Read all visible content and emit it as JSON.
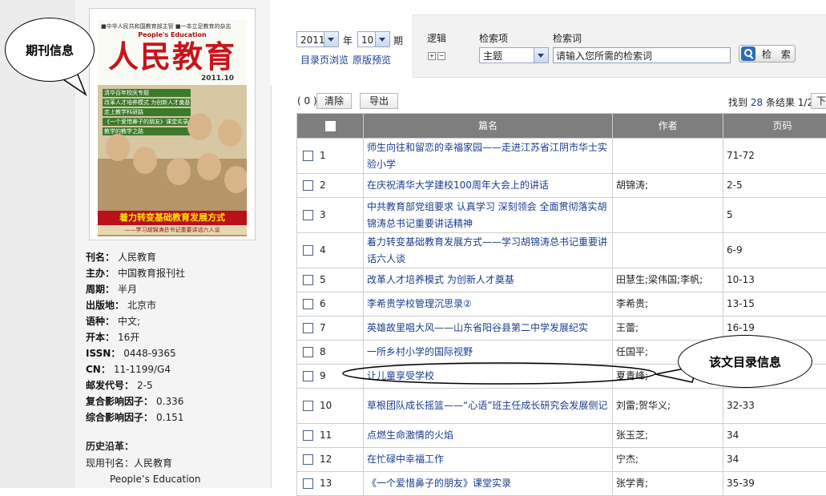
{
  "journal": {
    "cover_header": "■中华人民共和国教育部主管 ■一本立足教育的杂志",
    "cover_english": "People's Education",
    "cover_title": "人民教育",
    "cover_issue": "2011.10",
    "cover_lines": [
      "清华百年校庆专题",
      "改革人才培养模式 为创新人才奠基",
      "走上教学科研路",
      "《一个爱惜鼻子的朋友》课堂实录",
      "教学的教学之路"
    ],
    "cover_headline": "着力转变基础教育发展方式",
    "cover_subline": "——学习胡锦涛总书记重要讲话六人谈",
    "info": [
      {
        "key": "刊名：",
        "value": "人民教育"
      },
      {
        "key": "主办：",
        "value": "中国教育报刊社"
      },
      {
        "key": "周期：",
        "value": "半月"
      },
      {
        "key": "出版地：",
        "value": "北京市"
      },
      {
        "key": "语种：",
        "value": "中文;"
      },
      {
        "key": "开本：",
        "value": "16开"
      },
      {
        "key": "ISSN：",
        "value": "0448-9365"
      },
      {
        "key": "CN：",
        "value": "11-1199/G4"
      },
      {
        "key": "邮发代号：",
        "value": "2-5"
      },
      {
        "key": "复合影响因子：",
        "value": "0.336"
      },
      {
        "key": "综合影响因子：",
        "value": "0.151"
      }
    ],
    "history_label": "历史沿革：",
    "current_name": "现用刊名：人民教育",
    "english_name": "People’s Education"
  },
  "toolbar": {
    "year": "2011",
    "year_unit": "年",
    "issue": "10",
    "issue_unit": "期",
    "toc_link": "目录页浏览",
    "original_link": "原版预览",
    "logic_label": "逻辑",
    "field_label": "检索项",
    "keyword_label": "检索词",
    "field_value": "主题",
    "search_placeholder": "请输入您所需的检索词",
    "search_button": "检 索"
  },
  "results_bar": {
    "selected_count": "( 0 )",
    "clear_label": "清除",
    "export_label": "导出",
    "found_prefix": "找到",
    "found_count": "28",
    "found_suffix": "条结果",
    "page_info": "1/2",
    "next_label": "下"
  },
  "table": {
    "headers": {
      "title": "篇名",
      "author": "作者",
      "pages": "页码"
    },
    "rows": [
      {
        "num": "1",
        "title": "师生向往和留恋的幸福家园——走进江苏省江阴市华士实验小学",
        "author": "",
        "pages": "71-72",
        "tall": true
      },
      {
        "num": "2",
        "title": "在庆祝清华大学建校100周年大会上的讲话",
        "author": "胡锦涛;",
        "pages": "2-5",
        "tall": false
      },
      {
        "num": "3",
        "title": "中共教育部党组要求 认真学习 深刻领会 全面贯彻落实胡锦涛总书记重要讲话精神",
        "author": "",
        "pages": "5",
        "tall": true
      },
      {
        "num": "4",
        "title": "着力转变基础教育发展方式——学习胡锦涛总书记重要讲话六人谈",
        "author": "",
        "pages": "6-9",
        "tall": true
      },
      {
        "num": "5",
        "title": "改革人才培养模式 为创新人才奠基",
        "author": "田慧生;梁伟国;李帆;",
        "pages": "10-13",
        "tall": false
      },
      {
        "num": "6",
        "title": "李希贵学校管理沉思录②",
        "author": "李希贵;",
        "pages": "13-15",
        "tall": false
      },
      {
        "num": "7",
        "title": "英雄故里唱大风——山东省阳谷县第二中学发展纪实",
        "author": "王蕾;",
        "pages": "16-19",
        "tall": false
      },
      {
        "num": "8",
        "title": "一所乡村小学的国际视野",
        "author": "任国平;",
        "pages": "",
        "tall": false
      },
      {
        "num": "9",
        "title": "让儿童享受学校",
        "author": "夏青峰;",
        "pages": "",
        "tall": false
      },
      {
        "num": "10",
        "title": "草根团队成长摇篮——“心语”班主任成长研究会发展侧记",
        "author": "刘雷;贺华义;",
        "pages": "32-33",
        "tall": true
      },
      {
        "num": "11",
        "title": "点燃生命激情的火焰",
        "author": "张玉芝;",
        "pages": "34",
        "tall": false
      },
      {
        "num": "12",
        "title": "在忙碌中幸福工作",
        "author": "宁杰;",
        "pages": "34",
        "tall": false
      },
      {
        "num": "13",
        "title": "《一个爱惜鼻子的朋友》课堂实录",
        "author": "张学青;",
        "pages": "35-39",
        "tall": false
      }
    ]
  },
  "callouts": {
    "journal_info": "期刊信息",
    "article_info": "该文目录信息"
  },
  "colors": {
    "link": "#1a3c8f",
    "header_bg": "#7e7e7e",
    "cover_red": "#c8141c"
  }
}
